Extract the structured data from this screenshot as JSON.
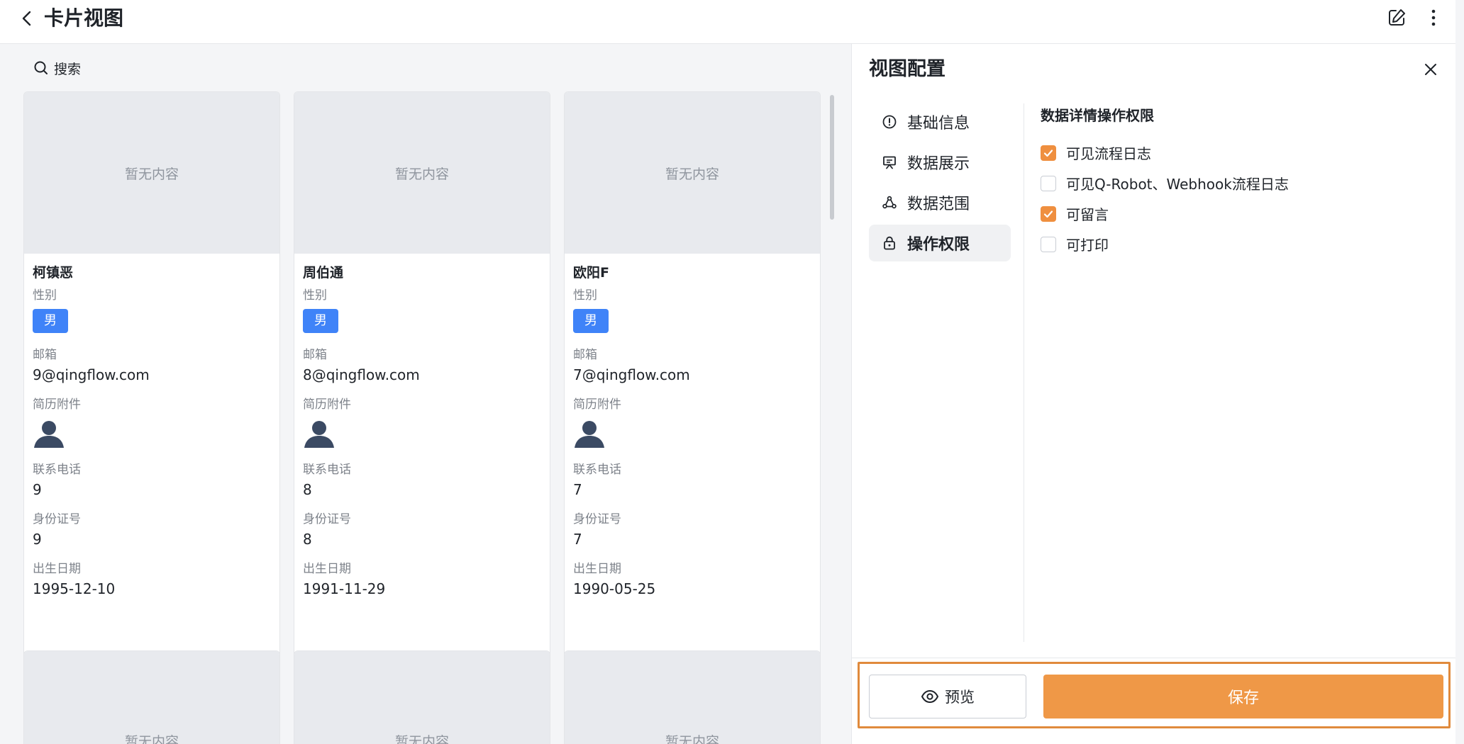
{
  "header": {
    "title": "卡片视图"
  },
  "search": {
    "label": "搜索"
  },
  "cards": [
    {
      "cover_text": "暂无内容",
      "name": "柯镇恶",
      "gender_label": "性别",
      "gender": "男",
      "email_label": "邮箱",
      "email": "9@qingflow.com",
      "resume_label": "简历附件",
      "phone_label": "联系电话",
      "phone": "9",
      "id_label": "身份证号",
      "id": "9",
      "birth_label": "出生日期",
      "birth": "1995-12-10"
    },
    {
      "cover_text": "暂无内容",
      "name": "周伯通",
      "gender_label": "性别",
      "gender": "男",
      "email_label": "邮箱",
      "email": "8@qingflow.com",
      "resume_label": "简历附件",
      "phone_label": "联系电话",
      "phone": "8",
      "id_label": "身份证号",
      "id": "8",
      "birth_label": "出生日期",
      "birth": "1991-11-29"
    },
    {
      "cover_text": "暂无内容",
      "name": "欧阳F",
      "gender_label": "性别",
      "gender": "男",
      "email_label": "邮箱",
      "email": "7@qingflow.com",
      "resume_label": "简历附件",
      "phone_label": "联系电话",
      "phone": "7",
      "id_label": "身份证号",
      "id": "7",
      "birth_label": "出生日期",
      "birth": "1990-05-25"
    }
  ],
  "bottom_cards": [
    {
      "cover_text": "暂无内容"
    },
    {
      "cover_text": "暂无内容"
    },
    {
      "cover_text": "暂无内容"
    }
  ],
  "panel": {
    "title": "视图配置",
    "menu": [
      {
        "label": "基础信息",
        "icon": "info-icon",
        "active": false
      },
      {
        "label": "数据展示",
        "icon": "display-icon",
        "active": false
      },
      {
        "label": "数据范围",
        "icon": "range-icon",
        "active": false
      },
      {
        "label": "操作权限",
        "icon": "lock-icon",
        "active": true
      }
    ],
    "permissions": {
      "title": "数据详情操作权限",
      "items": [
        {
          "label": "可见流程日志",
          "checked": true
        },
        {
          "label": "可见Q-Robot、Webhook流程日志",
          "checked": false
        },
        {
          "label": "可留言",
          "checked": true
        },
        {
          "label": "可打印",
          "checked": false
        }
      ]
    },
    "preview_label": "预览",
    "save_label": "保存"
  },
  "colors": {
    "accent": "#ef9847",
    "tag_blue": "#3f83f8",
    "checkbox_checked": "#ef8f3f"
  }
}
